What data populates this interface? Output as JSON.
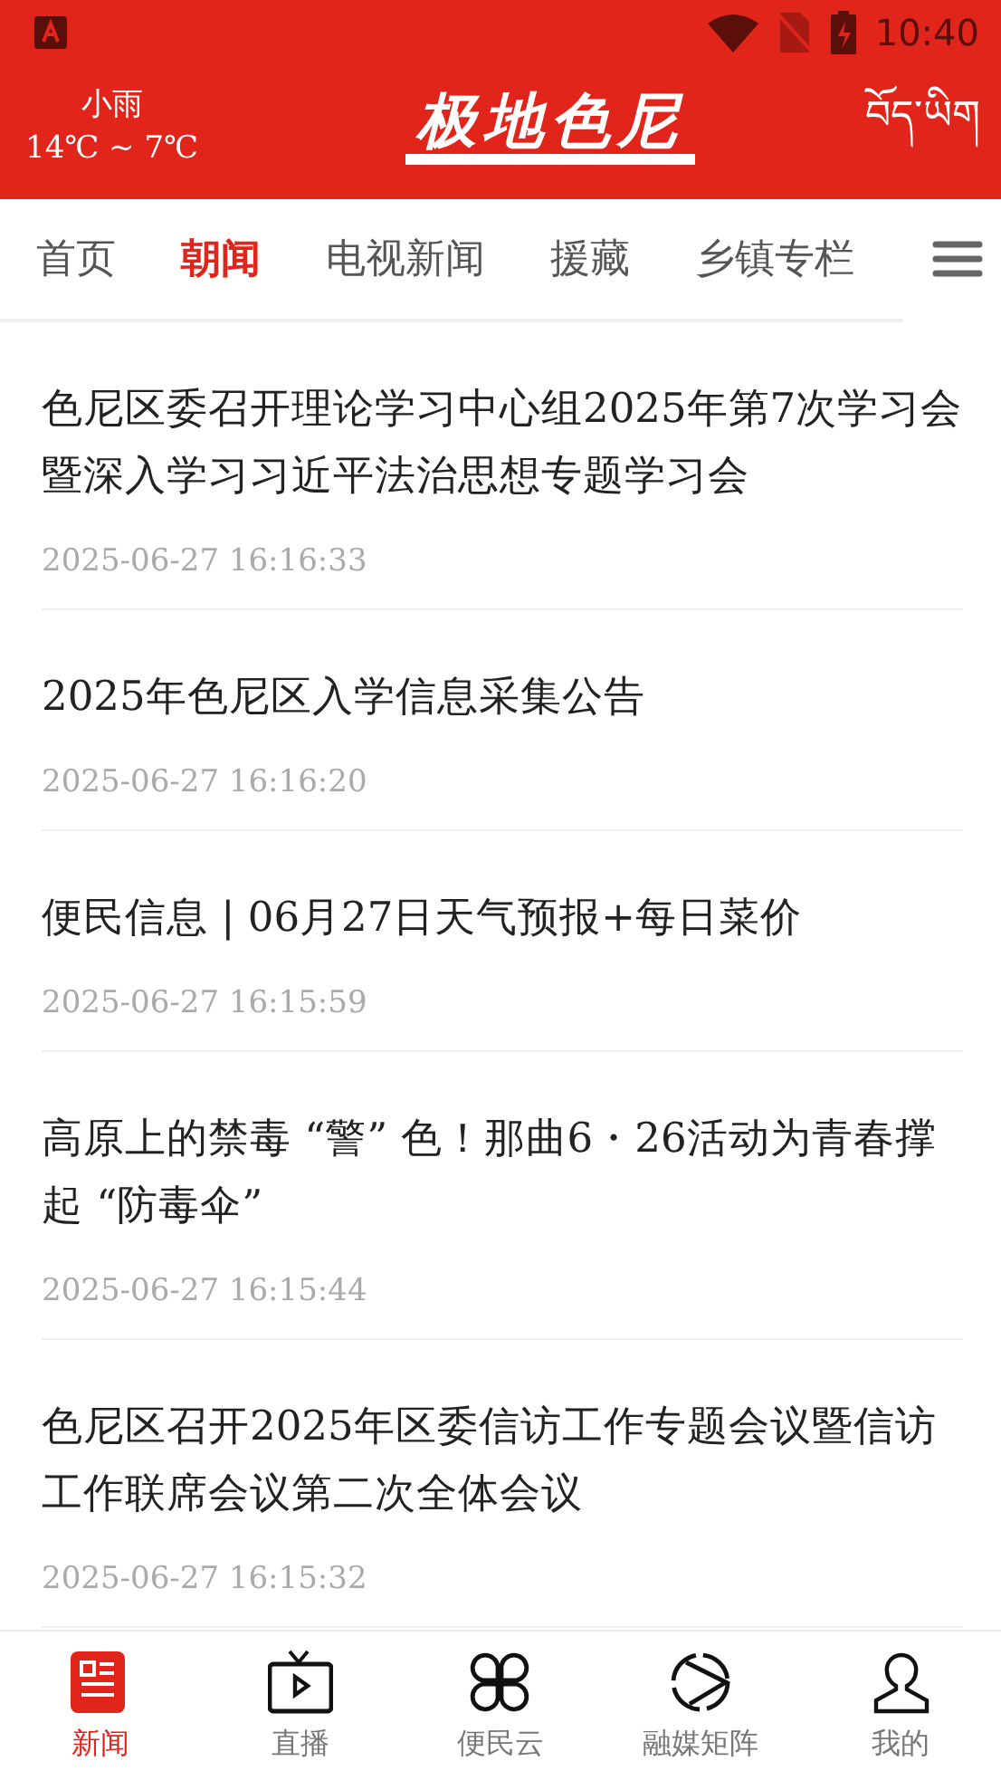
{
  "status_bar": {
    "time": "10:40"
  },
  "header": {
    "weather": "小雨",
    "temperature": "14℃ ~ 7℃",
    "logo": "极地色尼",
    "language": "བོད་ཡིག"
  },
  "tabs": [
    {
      "label": "首页",
      "selected": false
    },
    {
      "label": "朝闻",
      "selected": true
    },
    {
      "label": "电视新闻",
      "selected": false
    },
    {
      "label": "援藏",
      "selected": false
    },
    {
      "label": "乡镇专栏",
      "selected": false
    }
  ],
  "articles": [
    {
      "title": "色尼区委召开理论学习中心组2025年第7次学习会暨深入学习习近平法治思想专题学习会",
      "time": "2025-06-27 16:16:33"
    },
    {
      "title": "2025年色尼区入学信息采集公告",
      "time": "2025-06-27 16:16:20"
    },
    {
      "title": "便民信息 | 06月27日天气预报+每日菜价",
      "time": "2025-06-27 16:15:59"
    },
    {
      "title": "高原上的禁毒 “警” 色！那曲6・26活动为青春撑起 “防毒伞”",
      "time": "2025-06-27 16:15:44"
    },
    {
      "title": "色尼区召开2025年区委信访工作专题会议暨信访工作联席会议第二次全体会议",
      "time": "2025-06-27 16:15:32"
    }
  ],
  "bottom_nav": [
    {
      "label": "新闻",
      "kind": "news",
      "selected": true
    },
    {
      "label": "直播",
      "kind": "tv",
      "selected": false
    },
    {
      "label": "便民云",
      "kind": "clover",
      "selected": false
    },
    {
      "label": "融媒矩阵",
      "kind": "orbit",
      "selected": false
    },
    {
      "label": "我的",
      "kind": "user",
      "selected": false
    }
  ]
}
